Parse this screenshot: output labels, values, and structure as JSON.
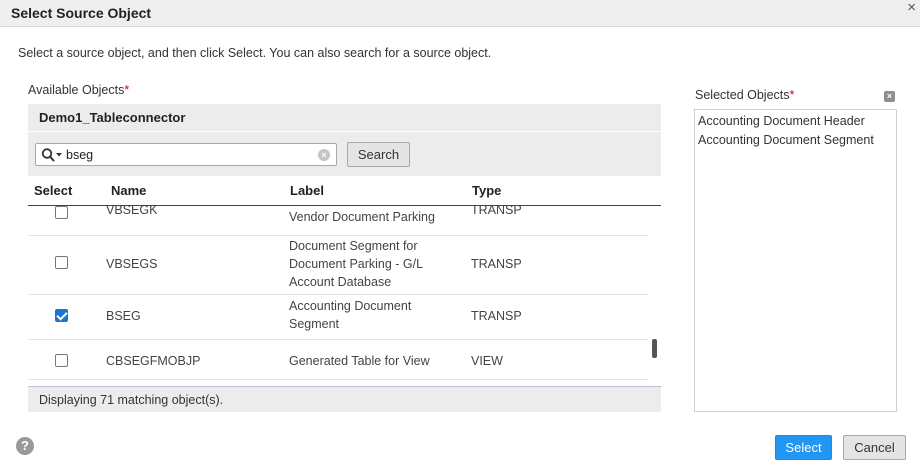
{
  "dialog": {
    "title": "Select Source Object",
    "close_glyph": "×",
    "instructions": "Select a source object, and then click Select. You can also search for a source object."
  },
  "available": {
    "label": "Available Objects",
    "required_mark": "*",
    "connection": "Demo1_Tableconnector",
    "search_value": "bseg",
    "search_button": "Search",
    "columns": {
      "select": "Select",
      "name": "Name",
      "label": "Label",
      "type": "Type"
    },
    "rows": [
      {
        "checked": false,
        "name": "VBSEGK",
        "label_lines": [
          "Vendor Document Parking"
        ],
        "type": "TRANSP"
      },
      {
        "checked": false,
        "name": "VBSEGS",
        "label_lines": [
          "Document Segment for",
          "Document Parking - G/L",
          "Account Database"
        ],
        "type": "TRANSP"
      },
      {
        "checked": true,
        "name": "BSEG",
        "label_lines": [
          "Accounting Document",
          "Segment"
        ],
        "type": "TRANSP"
      },
      {
        "checked": false,
        "name": "CBSEGFMOBJP",
        "label_lines": [
          "Generated Table for View"
        ],
        "type": "VIEW"
      }
    ],
    "status": "Displaying 71 matching object(s)."
  },
  "selected": {
    "label": "Selected Objects",
    "required_mark": "*",
    "items": [
      "Accounting Document Header",
      "Accounting Document Segment"
    ]
  },
  "footer": {
    "help_glyph": "?",
    "select_button": "Select",
    "cancel_button": "Cancel"
  },
  "icons": {
    "search": "magnifier-with-dropdown-icon",
    "clear": "clear-circle-x-icon",
    "help": "question-circle-icon",
    "remove_all": "box-x-icon"
  },
  "colors": {
    "primary_button": "#2196f3",
    "checkbox_checked": "#1976d2",
    "required": "#d0021b"
  }
}
